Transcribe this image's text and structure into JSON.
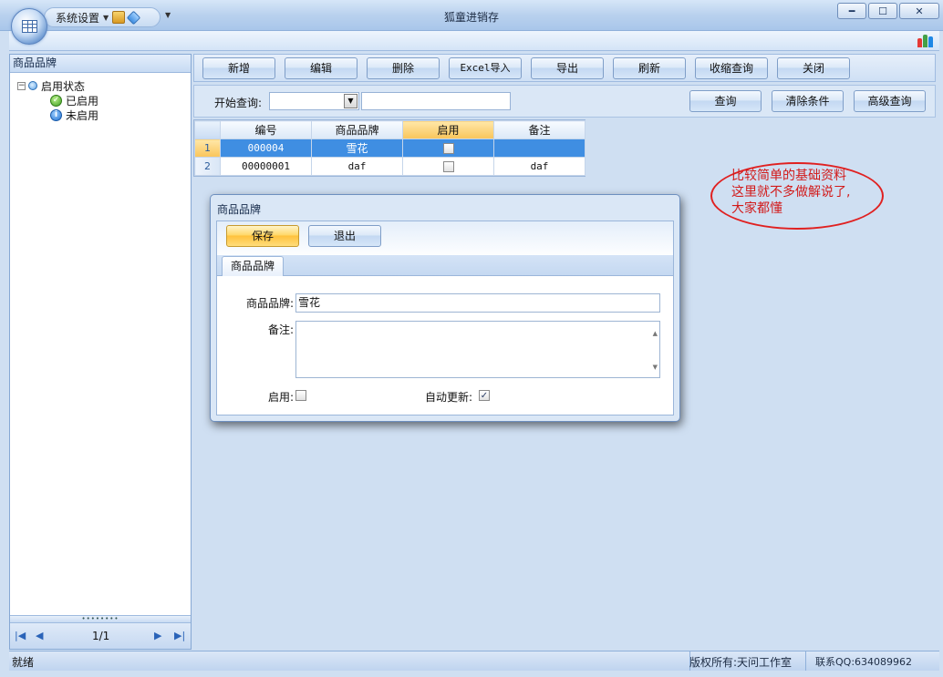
{
  "window": {
    "title": "狐童进销存",
    "qat_label": "系统设置",
    "minimize": "━",
    "maximize": "☐",
    "close": "✕"
  },
  "left_panel": {
    "header": "商品品牌",
    "tree_root": "启用状态",
    "tree_items": [
      "已启用",
      "未启用"
    ],
    "pager": "1/1"
  },
  "toolbar": {
    "buttons": [
      "新增",
      "编辑",
      "删除",
      "Excel导入",
      "导出",
      "刷新",
      "收缩查询",
      "关闭"
    ]
  },
  "query": {
    "label": "开始查询:",
    "buttons": [
      "查询",
      "清除条件",
      "高级查询"
    ]
  },
  "grid": {
    "columns": [
      "编号",
      "商品品牌",
      "启用",
      "备注"
    ],
    "rows": [
      {
        "num": "1",
        "code": "000004",
        "brand": "雪花",
        "enabled": false,
        "note": ""
      },
      {
        "num": "2",
        "code": "00000001",
        "brand": "daf",
        "enabled": false,
        "note": "daf"
      }
    ]
  },
  "annotation": {
    "lines": [
      "比较简单的基础资料",
      "这里就不多做解说了,",
      "大家都懂"
    ]
  },
  "dialog": {
    "title": "商品品牌",
    "save": "保存",
    "exit": "退出",
    "tab": "商品品牌",
    "brand_label": "商品品牌:",
    "brand_value": "雪花",
    "note_label": "备注:",
    "enabled_label": "启用:",
    "enabled": false,
    "auto_update_label": "自动更新:",
    "auto_update": true
  },
  "status": {
    "left": "就绪",
    "copyright": "版权所有:天问工作室",
    "contact": "联系QQ:634089962"
  }
}
